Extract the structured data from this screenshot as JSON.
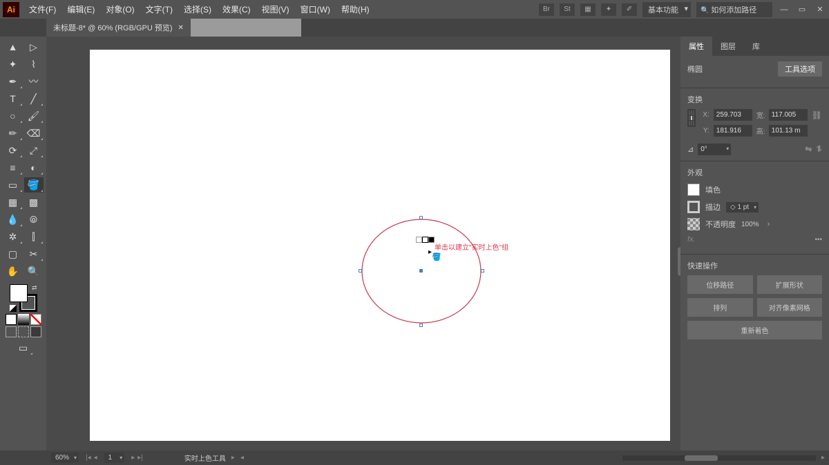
{
  "app": {
    "logo": "Ai"
  },
  "menu": {
    "file": "文件(F)",
    "edit": "编辑(E)",
    "object": "对象(O)",
    "type": "文字(T)",
    "select": "选择(S)",
    "effect": "效果(C)",
    "view": "视图(V)",
    "window": "窗口(W)",
    "help": "帮助(H)"
  },
  "workspace": "基本功能",
  "search_placeholder": "如何添加路径",
  "doc_tab": {
    "title": "未标题-8* @ 60% (RGB/GPU 预览)"
  },
  "canvas": {
    "tooltip": "单击以建立\"实时上色\"组"
  },
  "properties": {
    "tab_properties": "属性",
    "tab_layers": "图层",
    "tab_libraries": "库",
    "object_type": "椭圆",
    "tool_options_btn": "工具选项",
    "transform_label": "变换",
    "x": "259.703",
    "y": "181.916",
    "w": "117.005",
    "h": "101.13 m",
    "x_label": "X:",
    "y_label": "Y:",
    "w_label": "宽:",
    "h_label": "高:",
    "angle": "0°",
    "angle_symbol": "⊿",
    "appearance_label": "外观",
    "fill_label": "填色",
    "stroke_label": "描边",
    "stroke_weight": "1 pt",
    "opacity_label": "不透明度",
    "opacity_value": "100%",
    "fx_label": "fx.",
    "quick_label": "快速操作",
    "btn_offset": "位移路径",
    "btn_expand": "扩展形状",
    "btn_arrange": "排列",
    "btn_align_pixel": "对齐像素网格",
    "btn_recolor": "重新着色"
  },
  "status": {
    "zoom": "60%",
    "artboard_num": "1",
    "current_tool": "实时上色工具"
  },
  "tools": {
    "selection": "▲",
    "direct": "▷",
    "wand": "✦",
    "lasso": "⌇",
    "pen": "✒",
    "curve": "〰",
    "type": "T",
    "line": "╱",
    "ellipse": "○",
    "brush": "🖌",
    "pencil": "✏",
    "eraser": "⌫",
    "rotate": "⟳",
    "scale": "⤢",
    "width": "≡",
    "warp": "◐",
    "shaper": "▭",
    "shape": "◆",
    "perspective": "▦",
    "mesh": "▩",
    "eyedrop": "💧",
    "blend": "⦾",
    "symbol": "✲",
    "graph": "⫿",
    "artboard": "▢",
    "slice": "✂",
    "hand": "✋",
    "zoom": "🔍",
    "livepaint": "🪣",
    "gradient": "▨"
  },
  "colors": {
    "mode1": "#ffffff",
    "mode2": "#000000",
    "mode3_a": "#ff0000",
    "mode3_b": "#ffffff"
  }
}
